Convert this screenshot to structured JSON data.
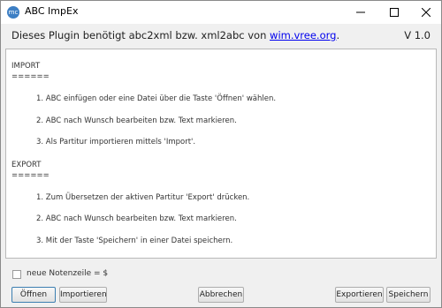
{
  "window": {
    "title": "ABC ImpEx",
    "icon_text": "mc"
  },
  "header": {
    "message_prefix": "Dieses Plugin benötigt abc2xml bzw. xml2abc von ",
    "link_text": "wim.vree.org",
    "message_suffix": ".",
    "version": "V 1.0"
  },
  "instructions": {
    "import_heading": "IMPORT",
    "import_underline": "======",
    "import_steps": [
      "1. ABC einfügen oder eine Datei über die Taste 'Öffnen' wählen.",
      "2. ABC nach Wunsch bearbeiten bzw. Text markieren.",
      "3. Als Partitur importieren mittels 'Import'."
    ],
    "export_heading": "EXPORT",
    "export_underline": "======",
    "export_steps": [
      "1. Zum Übersetzen der aktiven Partitur 'Export' drücken.",
      "2. ABC nach Wunsch bearbeiten bzw. Text markieren.",
      "3. Mit der Taste 'Speichern' in einer Datei speichern."
    ]
  },
  "options": {
    "newline_checkbox_label": "neue Notenzeile = $",
    "newline_checked": false
  },
  "buttons": {
    "open": "Öffnen",
    "import": "Importieren",
    "cancel": "Abbrechen",
    "export": "Exportieren",
    "save": "Speichern"
  },
  "colors": {
    "link": "#0000ee",
    "app_icon": "#3d7fc4"
  }
}
